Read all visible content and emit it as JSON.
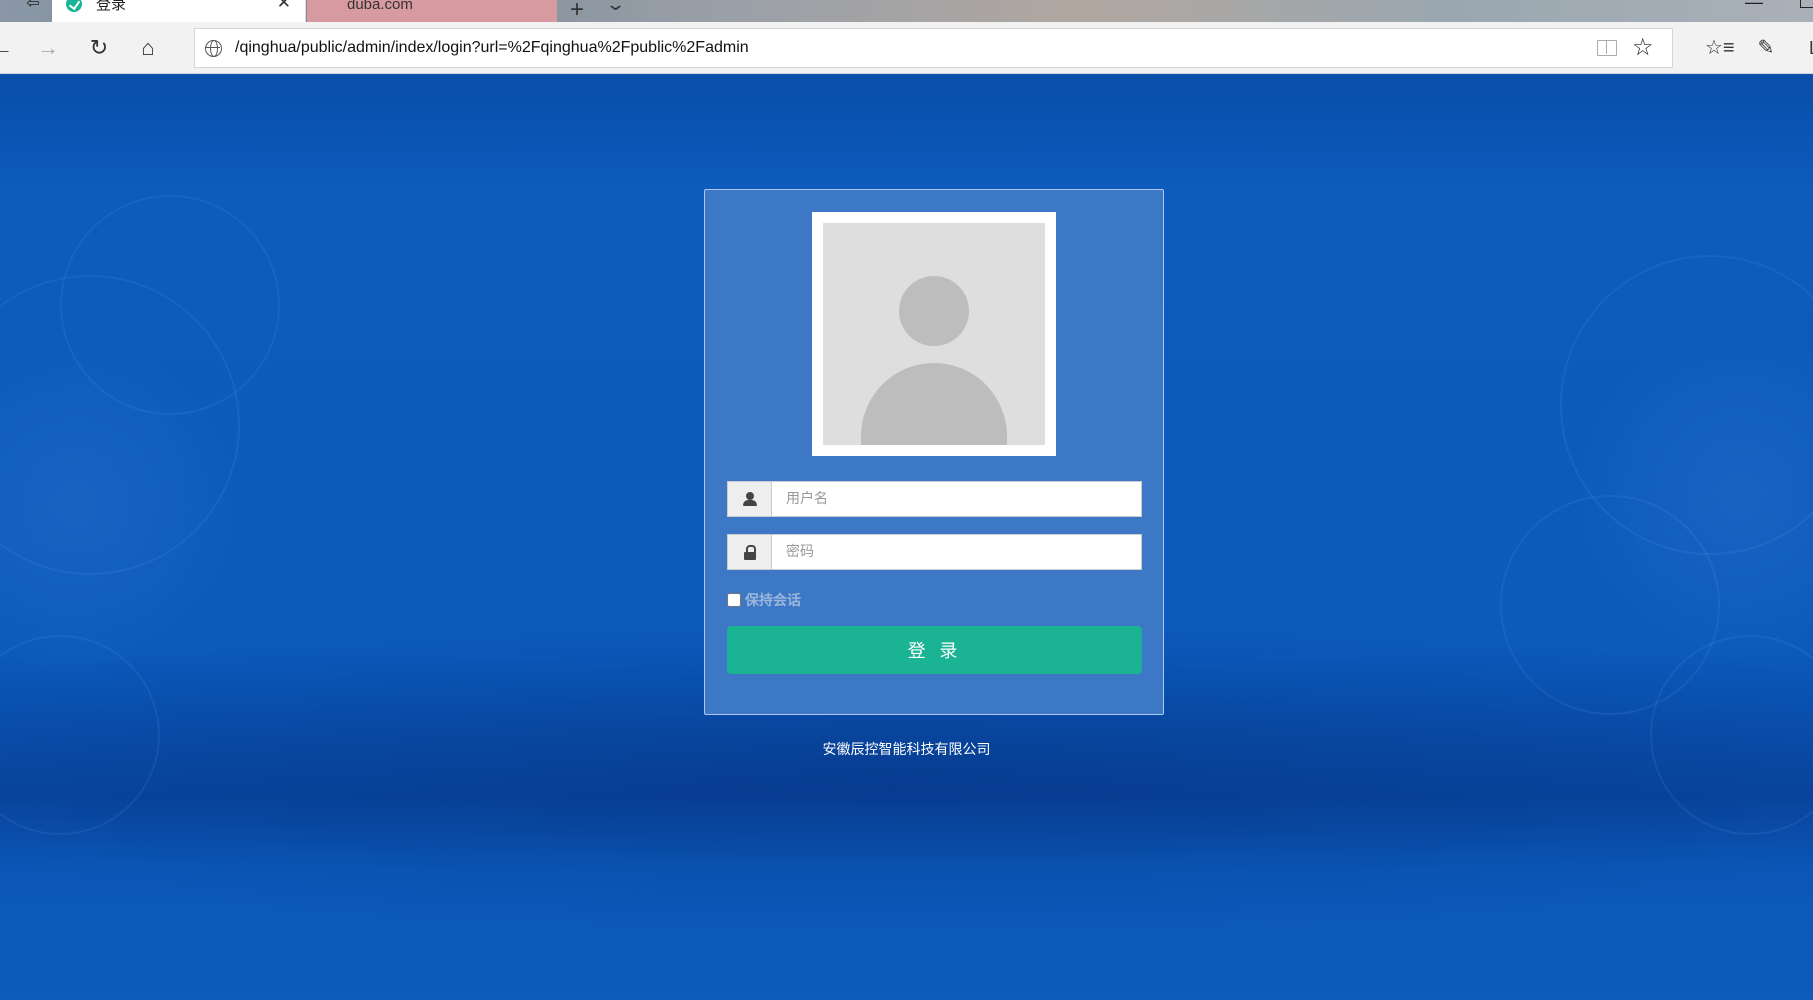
{
  "browser": {
    "tabs": [
      {
        "title": "登录",
        "active": true
      },
      {
        "title": "duba.com",
        "active": false
      }
    ],
    "url": "/qinghua/public/admin/index/login?url=%2Fqinghua%2Fpublic%2Fadmin",
    "icons": {
      "back": "back-arrow-icon",
      "forward": "forward-arrow-icon",
      "refresh": "refresh-icon",
      "home": "home-icon",
      "favorite": "star-icon",
      "favorites_hub": "favorites-list-icon",
      "notes": "pen-icon"
    },
    "profile_letter": "L"
  },
  "login": {
    "username_placeholder": "用户名",
    "password_placeholder": "密码",
    "remember_label": "保持会话",
    "remember_checked": false,
    "submit_label": "登 录"
  },
  "footer": {
    "company": "安徽辰控智能科技有限公司"
  },
  "colors": {
    "page_background": "#0b5abc",
    "login_panel": "#3d78c6",
    "submit_button": "#1ab394"
  }
}
